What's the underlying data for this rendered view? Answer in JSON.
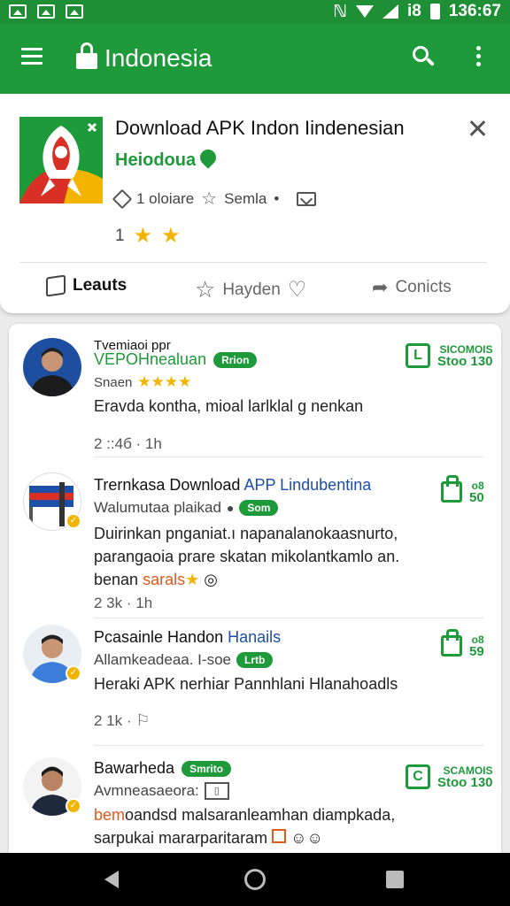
{
  "status_bar": {
    "time": "136:67",
    "carrier": "i8"
  },
  "app_bar": {
    "title": "Indonesia"
  },
  "app_card": {
    "name": "Download APK Indon Iindenesian",
    "developer": "Heiodoua",
    "meta_downloads": "1 oloiare",
    "meta_category": "Semla",
    "meta_dot": "•",
    "rating_count": "1",
    "actions": {
      "leauts": "Leauts",
      "hayden": "Hayden",
      "conicts": "Conicts"
    }
  },
  "reviews": [
    {
      "title_top": "Tvemiaoi ppr",
      "name": "VEPOHnealuan",
      "badge": "Rrion",
      "sub": "Snaen",
      "body": "Eravda kontha, mioal larlklal g nenkan",
      "meta": "2 ::4б · 1h",
      "right_top": "SICOMOIS",
      "right_bottom": "Stoo 130"
    },
    {
      "name_part1": "Trernkasa Download",
      "name_part2": "APP Lindubentina",
      "sub": "Walumutaa plaikad",
      "badge": "Som",
      "body_line1": "Duirinkan pnganiat.ı napanalanokaasnurto,",
      "body_line2": "parangaoia prare skatan mikolantkamlo an.",
      "body_line3_a": "benan ",
      "body_line3_b": "sarals",
      "meta": "2 3k · 1h",
      "right_top": "o8",
      "right_bottom": "50"
    },
    {
      "name_part1": "Pcasainle Handon",
      "name_part2": "Hanails",
      "sub": "Allamkeadeaa. I-soe",
      "badge": "Lrtb",
      "body": "Heraki APK nerhiar Pannhlani Hlanahoadls",
      "meta": "2 1k · ",
      "right_top": "o8",
      "right_bottom": "59"
    },
    {
      "name": "Bawarheda",
      "badge": "Smrito",
      "sub": "Avmneasaeora:",
      "body_line1_a": "bem",
      "body_line1_b": "oandsd malsaranleamhan diampkada,",
      "body_line2": "sarpukai mararparitaram",
      "right_top": "SCAMOIS",
      "right_bottom": "Stoo 130"
    }
  ],
  "colors": {
    "brand_green": "#1f9a3a",
    "status_green": "#1f8f36",
    "star_gold": "#f2b400",
    "link_blue": "#1e4fa8"
  }
}
